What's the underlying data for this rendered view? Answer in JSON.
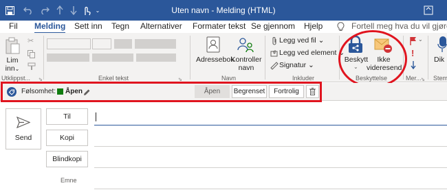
{
  "window": {
    "title": "Uten navn - Melding (HTML)"
  },
  "tabs": [
    "Fil",
    "Melding",
    "Sett inn",
    "Tegn",
    "Alternativer",
    "Formater tekst",
    "Se gjennom",
    "Hjelp"
  ],
  "tell_me": "Fortell meg hva du vil gjøre",
  "ribbon": {
    "paste_label_1": "Lim",
    "paste_label_2": "inn",
    "address_book": "Adressebok",
    "check_names_1": "Kontroller",
    "check_names_2": "navn",
    "attach_file": "Legg ved fil",
    "attach_item": "Legg ved element",
    "signature": "Signatur",
    "protect": "Beskytt",
    "do_not_forward_1": "Ikke",
    "do_not_forward_2": "videresend",
    "dictate": "Dik"
  },
  "groups": {
    "clipboard": "Utklippst...",
    "basic_text": "Enkel tekst",
    "names": "Navn",
    "include": "Inkluder",
    "protection": "Beskyttelse",
    "more": "Mer...",
    "voice": "Stem"
  },
  "sensitivity": {
    "label": "Følsomhet:",
    "current": "Åpen",
    "options": [
      "Åpen",
      "Begrenset",
      "Fortrolig"
    ]
  },
  "compose": {
    "send": "Send",
    "to": "Til",
    "cc": "Kopi",
    "bcc": "Blindkopi",
    "subject": "Emne"
  },
  "colors": {
    "accent": "#2b579a",
    "highlight": "#e0141f",
    "sensitivity_green": "#107c10"
  }
}
